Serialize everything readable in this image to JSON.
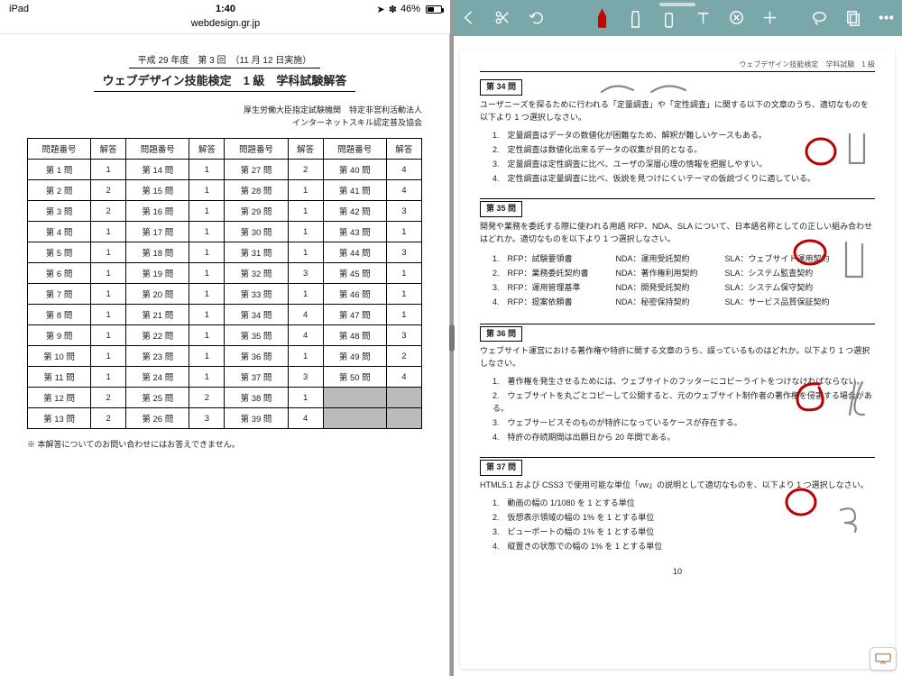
{
  "status": {
    "device": "iPad",
    "time": "1:40",
    "battery_pct": "46%",
    "nav_glyph": "➤",
    "bt_glyph": "✽"
  },
  "safari": {
    "url": "webdesign.gr.jp"
  },
  "left_doc": {
    "line1": "平成 29 年度　第 3 回　（11 月 12 日実施）",
    "title": "ウェブデザイン技能検定　1 級　学科試験解答",
    "sub1": "厚生労働大臣指定試験機関　特定非営利活動法人",
    "sub2": "インターネットスキル認定普及協会",
    "note": "※ 本解答についてのお問い合わせにはお答えできません。",
    "col_headers": [
      "問題番号",
      "解答",
      "問題番号",
      "解答",
      "問題番号",
      "解答",
      "問題番号",
      "解答"
    ],
    "rows": [
      [
        "第 1 問",
        "1",
        "第 14 問",
        "1",
        "第 27 問",
        "2",
        "第 40 問",
        "4"
      ],
      [
        "第 2 問",
        "2",
        "第 15 問",
        "1",
        "第 28 問",
        "1",
        "第 41 問",
        "4"
      ],
      [
        "第 3 問",
        "2",
        "第 16 問",
        "1",
        "第 29 問",
        "1",
        "第 42 問",
        "3"
      ],
      [
        "第 4 問",
        "1",
        "第 17 問",
        "1",
        "第 30 問",
        "1",
        "第 43 問",
        "1"
      ],
      [
        "第 5 問",
        "1",
        "第 18 問",
        "1",
        "第 31 問",
        "1",
        "第 44 問",
        "3"
      ],
      [
        "第 6 問",
        "1",
        "第 19 問",
        "1",
        "第 32 問",
        "3",
        "第 45 問",
        "1"
      ],
      [
        "第 7 問",
        "1",
        "第 20 問",
        "1",
        "第 33 問",
        "1",
        "第 46 問",
        "1"
      ],
      [
        "第 8 問",
        "1",
        "第 21 問",
        "1",
        "第 34 問",
        "4",
        "第 47 問",
        "1"
      ],
      [
        "第 9 問",
        "1",
        "第 22 問",
        "1",
        "第 35 問",
        "4",
        "第 48 問",
        "3"
      ],
      [
        "第 10 問",
        "1",
        "第 23 問",
        "1",
        "第 36 問",
        "1",
        "第 49 問",
        "2"
      ],
      [
        "第 11 問",
        "1",
        "第 24 問",
        "1",
        "第 37 問",
        "3",
        "第 50 問",
        "4"
      ],
      [
        "第 12 問",
        "2",
        "第 25 問",
        "2",
        "第 38 問",
        "1",
        "",
        ""
      ],
      [
        "第 13 問",
        "2",
        "第 26 問",
        "3",
        "第 39 問",
        "4",
        "",
        ""
      ]
    ]
  },
  "right_doc": {
    "header": "ウェブデザイン技能検定　学科試験　1 級",
    "page": "10",
    "q34": {
      "label": "第 34 問",
      "text": "ユーザニーズを探るために行われる「定量調査」や「定性調査」に関する以下の文章のうち、適切なものを以下より 1 つ選択しなさい。",
      "opts": [
        "定量調査はデータの数値化が困難なため、解釈が難しいケースもある。",
        "定性調査は数値化出来るデータの収集が目的となる。",
        "定量調査は定性調査に比べ、ユーザの深層心理の情報を把握しやすい。",
        "定性調査は定量調査に比べ、仮説を見つけにくいテーマの仮説づくりに適している。"
      ]
    },
    "q35": {
      "label": "第 35 問",
      "text": "開発や業務を委託する際に使われる用語 RFP、NDA、SLA について、日本語名称としての正しい組み合わせはどれか。適切なものを以下より 1 つ選択しなさい。",
      "rfp": [
        "RFP：試験要領書",
        "RFP：業務委託契約書",
        "RFP：運用管理基準",
        "RFP：提案依頼書"
      ],
      "nda": [
        "NDA：運用受託契約",
        "NDA：著作権利用契約",
        "NDA：開発受託契約",
        "NDA：秘密保持契約"
      ],
      "sla": [
        "SLA：ウェブサイト運用契約",
        "SLA：システム監査契約",
        "SLA：システム保守契約",
        "SLA：サービス品質保証契約"
      ]
    },
    "q36": {
      "label": "第 36 問",
      "text": "ウェブサイト運営における著作権や特許に関する文章のうち、誤っているものはどれか。以下より 1 つ選択しなさい。",
      "opts": [
        "著作権を発生させるためには、ウェブサイトのフッターにコピーライトをつけなければならない。",
        "ウェブサイトを丸ごとコピーして公開すると、元のウェブサイト制作者の著作権を侵害する場合がある。",
        "ウェブサービスそのものが特許になっているケースが存在する。",
        "特許の存続期間は出願日から 20 年間である。"
      ]
    },
    "q37": {
      "label": "第 37 問",
      "text": "HTML5.1 および CSS3 で使用可能な単位「vw」の説明として適切なものを、以下より 1 つ選択しなさい。",
      "opts": [
        "動画の幅の 1/1080 を 1 とする単位",
        "仮想表示領域の幅の 1% を 1 とする単位",
        "ビューポートの幅の 1% を 1 とする単位",
        "縦置きの状態での幅の 1% を 1 とする単位"
      ]
    }
  }
}
